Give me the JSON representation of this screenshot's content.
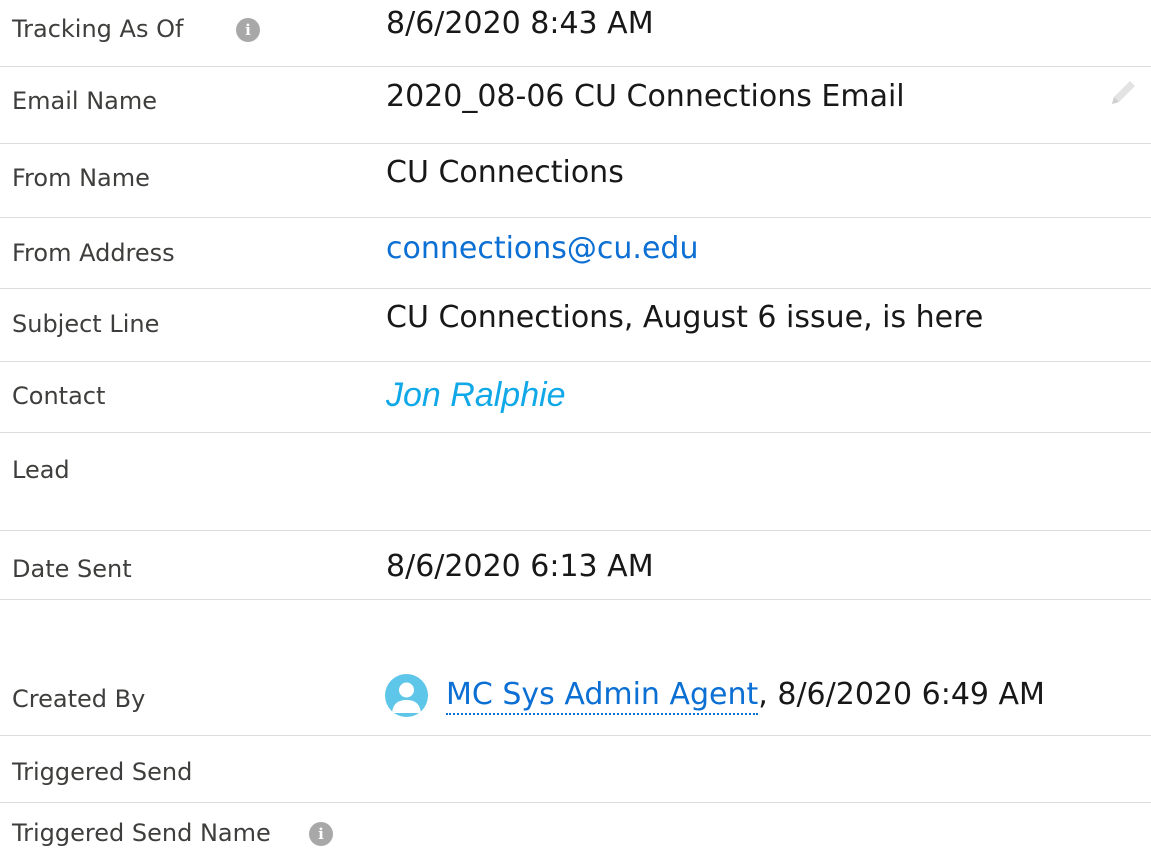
{
  "fields": {
    "tracking_as_of": {
      "label": "Tracking As Of",
      "value": "8/6/2020 8:43 AM"
    },
    "email_name": {
      "label": "Email Name",
      "value": "2020_08-06 CU Connections Email"
    },
    "from_name": {
      "label": "From Name",
      "value": "CU Connections"
    },
    "from_address": {
      "label": "From Address",
      "value": "connections@cu.edu"
    },
    "subject_line": {
      "label": "Subject Line",
      "value": "CU Connections, August 6 issue, is here"
    },
    "contact": {
      "label": "Contact",
      "value": "Jon Ralphie"
    },
    "lead": {
      "label": "Lead",
      "value": ""
    },
    "date_sent": {
      "label": "Date Sent",
      "value": "8/6/2020 6:13 AM"
    },
    "created_by": {
      "label": "Created By",
      "user": "MC Sys Admin Agent",
      "separator": ", ",
      "date": "8/6/2020 6:49 AM"
    },
    "triggered_send": {
      "label": "Triggered Send",
      "value": ""
    },
    "triggered_send_name": {
      "label": "Triggered Send Name",
      "value": ""
    }
  },
  "icons": {
    "info": "info-icon",
    "edit": "pencil-icon",
    "avatar": "user-avatar-icon"
  },
  "colors": {
    "link": "#0b6fd3",
    "contact": "#11a8e8",
    "avatar": "#5ec6e9",
    "info_icon": "#a8a8a8",
    "divider": "#dcdcdc"
  }
}
